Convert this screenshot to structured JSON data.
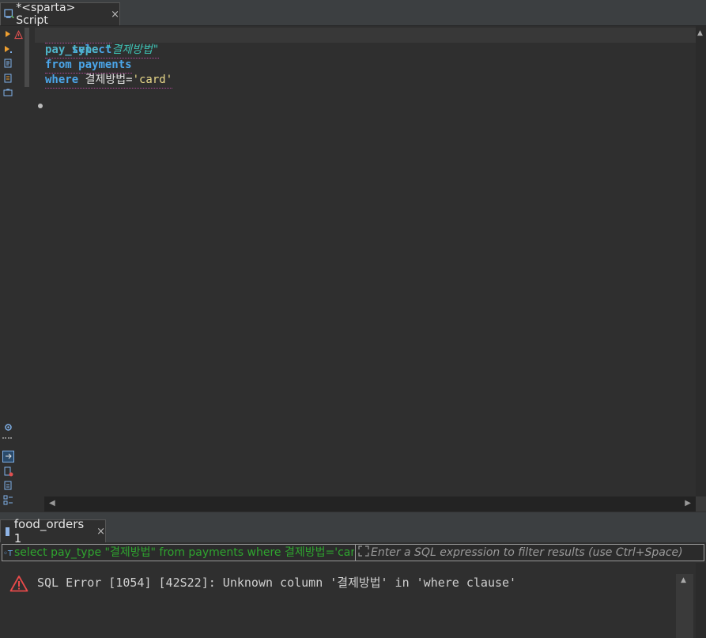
{
  "editor": {
    "tab_title": "*<sparta> Script",
    "tab_close": "×",
    "code": {
      "line1": {
        "kw": "select"
      },
      "line2": {
        "col": "pay_type",
        "alias": "\"결제방법\""
      },
      "line3": {
        "kw": "from",
        "table": "payments"
      },
      "line4": {
        "kw": "where",
        "col": "결제방법",
        "op": "=",
        "val": "'card'"
      }
    }
  },
  "results": {
    "tab_title": "food_orders 1",
    "tab_close": "×",
    "filter": {
      "sql_prefix": "◦T",
      "sql_text": "select pay_type \"결제방법\" from payments where 결제방법='card'",
      "placeholder": "Enter a SQL expression to filter results (use Ctrl+Space)"
    },
    "error_message": "SQL Error [1054] [42S22]: Unknown column '결제방법' in 'where clause'"
  },
  "colors": {
    "keyword": "#4ba6ea",
    "alias": "#3fc2b4",
    "string": "#e9d98a",
    "filter_sql": "#2fa52f",
    "error_icon": "#e84a4a"
  },
  "icons": {
    "tab": "sql-script-icon",
    "error": "warning-triangle-icon"
  }
}
